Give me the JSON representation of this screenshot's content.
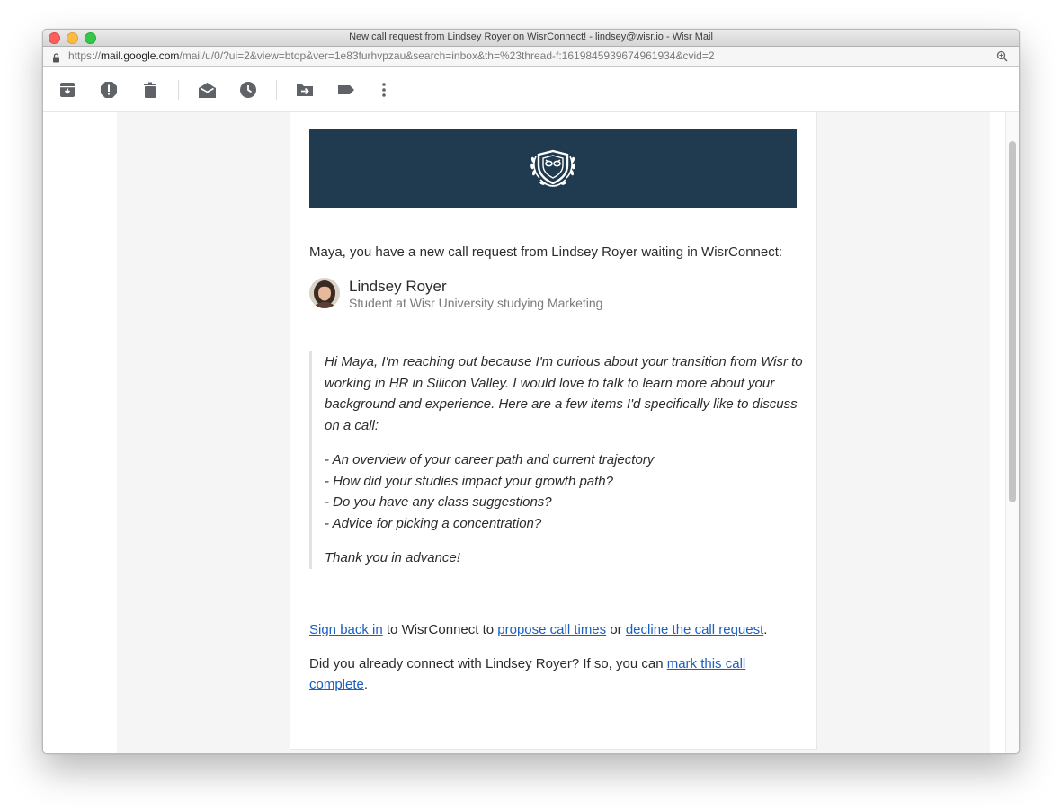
{
  "window": {
    "title": "New call request from Lindsey Royer on WisrConnect! - lindsey@wisr.io - Wisr Mail"
  },
  "urlbar": {
    "scheme": "https://",
    "host": "mail.google.com",
    "path": "/mail/u/0/?ui=2&view=btop&ver=1e83furhvpzau&search=inbox&th=%23thread-f:1619845939674961934&cvid=2"
  },
  "toolbar": {
    "buttons": [
      {
        "name": "archive",
        "icon": "archive-icon"
      },
      {
        "name": "report-spam",
        "icon": "report-spam-icon"
      },
      {
        "name": "delete",
        "icon": "trash-icon"
      },
      {
        "name": "mark-unread",
        "icon": "mark-unread-icon"
      },
      {
        "name": "snooze",
        "icon": "clock-icon"
      },
      {
        "name": "move-to",
        "icon": "move-to-icon"
      },
      {
        "name": "labels",
        "icon": "label-icon"
      },
      {
        "name": "more",
        "icon": "more-vert-icon"
      }
    ]
  },
  "email": {
    "intro": "Maya, you have a new call request from Lindsey Royer waiting in WisrConnect:",
    "sender_name": "Lindsey Royer",
    "sender_subtitle": "Student at Wisr University studying Marketing",
    "message_intro": "Hi Maya, I'm reaching out because I'm curious about your transition from Wisr to working in HR in Silicon Valley. I would love to talk to learn more about your background and experience. Here are a few items I'd specifically like to discuss on a call:",
    "message_items": [
      "- An overview of your career path and current trajectory",
      "- How did your studies impact your growth path?",
      "- Do you have any class suggestions?",
      "- Advice for picking a concentration?"
    ],
    "message_closing": "Thank you in advance!",
    "action_line": {
      "sign_in_link": "Sign back in",
      "text_1": " to WisrConnect to ",
      "propose_link": "propose call times",
      "text_2": " or ",
      "decline_link": "decline the call request",
      "text_3": "."
    },
    "complete_line": {
      "text_1": "Did you already connect with Lindsey Royer? If so, you can ",
      "complete_link": "mark this call complete",
      "text_2": "."
    }
  },
  "colors": {
    "banner": "#203a4f",
    "link": "#1a5fc2",
    "traffic_close": "#fc605b",
    "traffic_min": "#fdbc40",
    "traffic_max": "#34c84a"
  }
}
